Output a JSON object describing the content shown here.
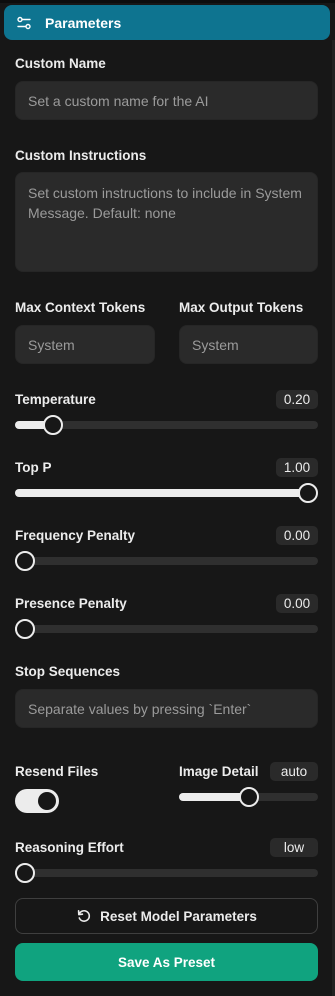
{
  "header": {
    "title": "Parameters",
    "icon": "sliders-icon"
  },
  "custom_name": {
    "label": "Custom Name",
    "placeholder": "Set a custom name for the AI"
  },
  "custom_instructions": {
    "label": "Custom Instructions",
    "placeholder": "Set custom instructions to include in System Message. Default: none"
  },
  "max_context_tokens": {
    "label": "Max Context Tokens",
    "placeholder": "System"
  },
  "max_output_tokens": {
    "label": "Max Output Tokens",
    "placeholder": "System"
  },
  "temperature": {
    "label": "Temperature",
    "value": "0.20",
    "fraction": 0.1
  },
  "top_p": {
    "label": "Top P",
    "value": "1.00",
    "fraction": 1.0
  },
  "frequency_penalty": {
    "label": "Frequency Penalty",
    "value": "0.00",
    "fraction": 0.0
  },
  "presence_penalty": {
    "label": "Presence Penalty",
    "value": "0.00",
    "fraction": 0.0
  },
  "stop_sequences": {
    "label": "Stop Sequences",
    "placeholder": "Separate values by pressing `Enter`"
  },
  "resend_files": {
    "label": "Resend Files",
    "enabled": true
  },
  "image_detail": {
    "label": "Image Detail",
    "value": "auto",
    "fraction": 0.5
  },
  "reasoning_effort": {
    "label": "Reasoning Effort",
    "value": "low",
    "fraction": 0.0
  },
  "buttons": {
    "reset": "Reset Model Parameters",
    "save": "Save As Preset"
  },
  "colors": {
    "header": "#0e7490",
    "save": "#10a37f",
    "background": "#171717",
    "field": "#2a2a2a"
  }
}
